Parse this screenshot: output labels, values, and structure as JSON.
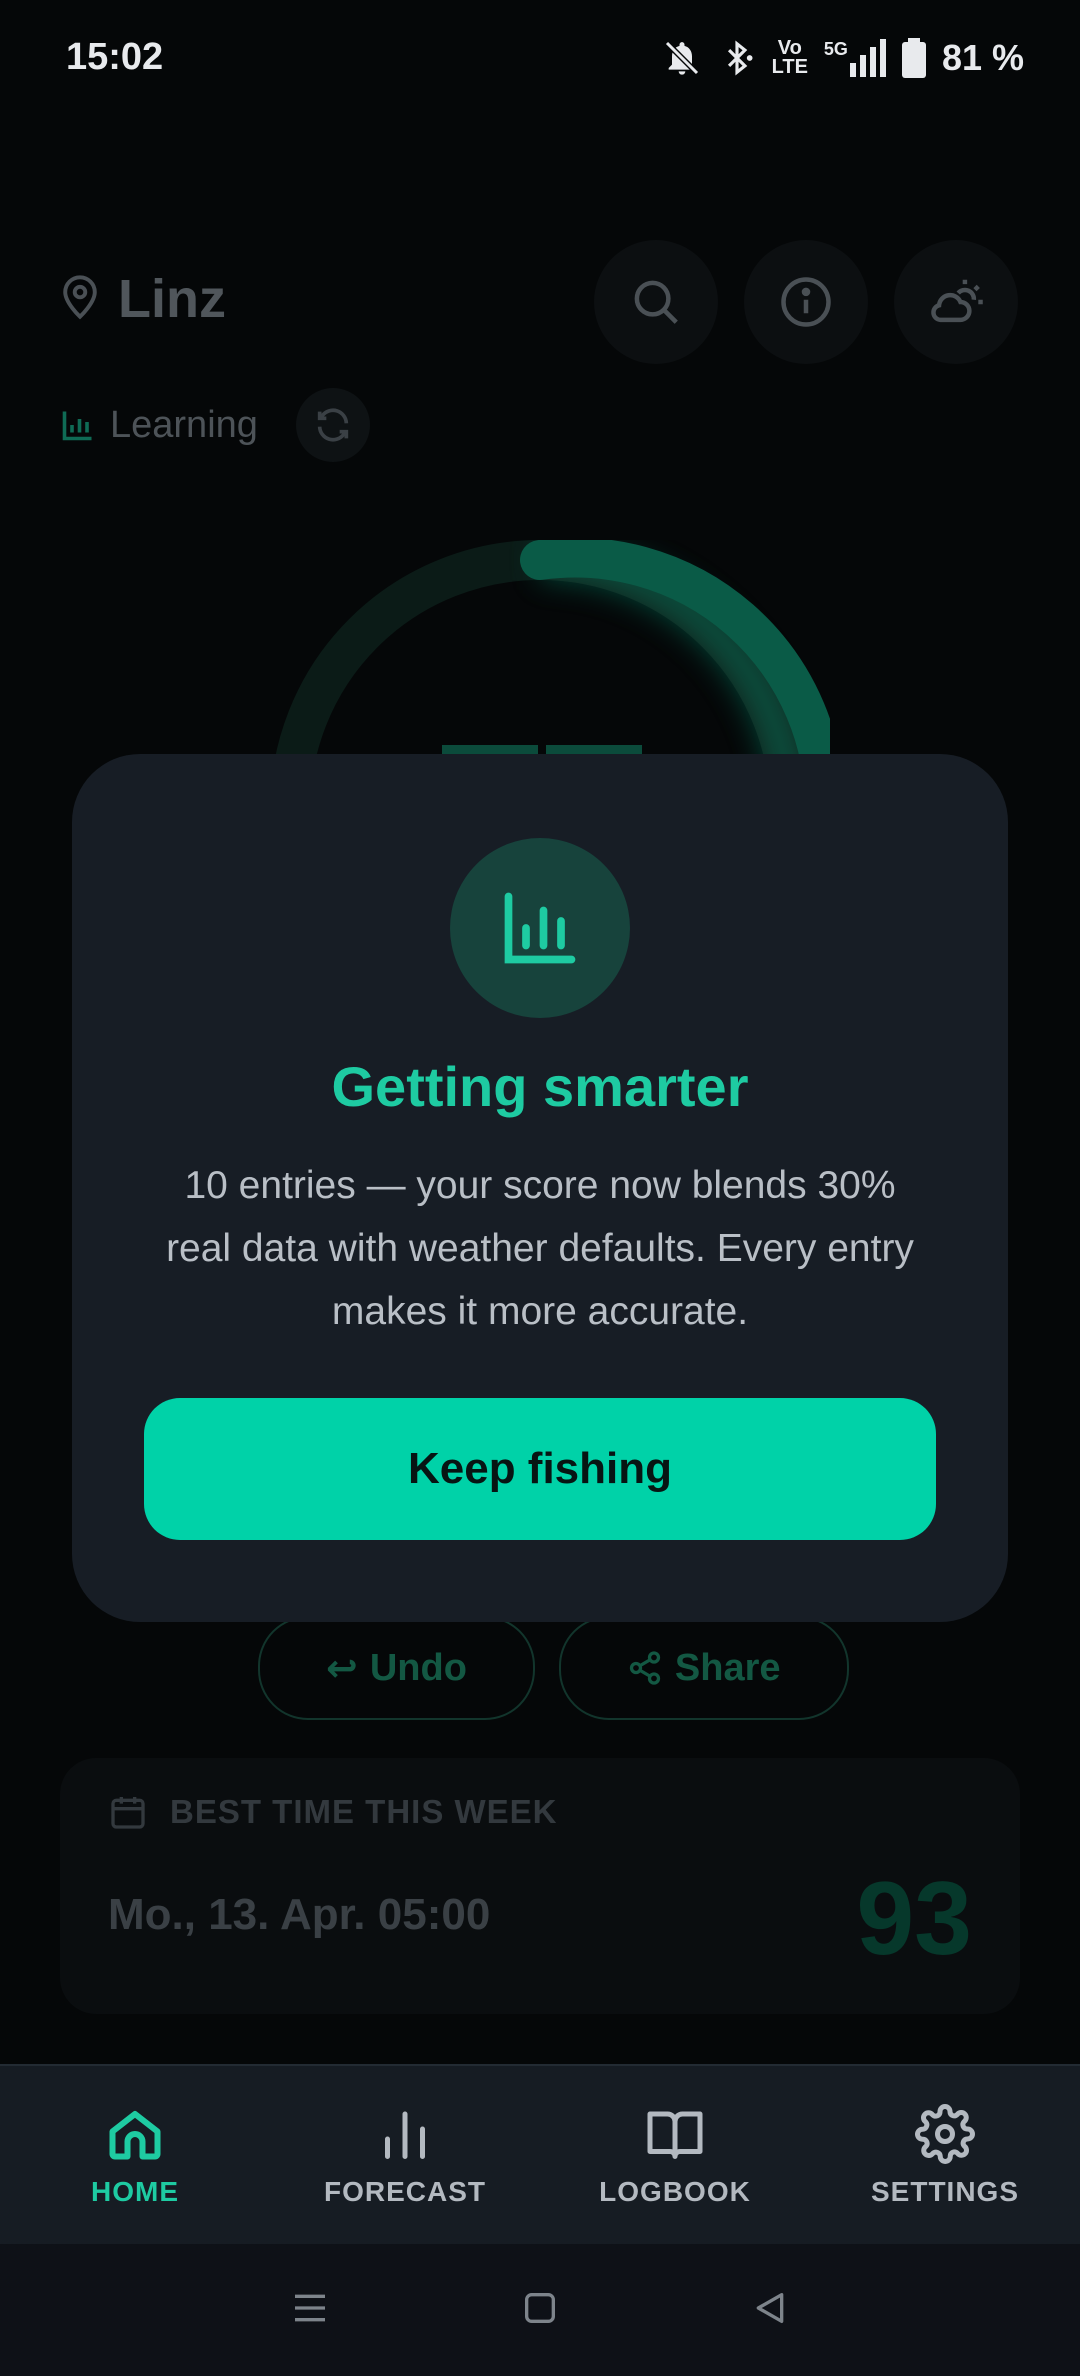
{
  "status_bar": {
    "time": "15:02",
    "network": [
      "Vo",
      "LTE"
    ],
    "signal": "5G",
    "battery": "81 %"
  },
  "header": {
    "location": "Linz",
    "learning_label": "Learning"
  },
  "actions": {
    "undo_label": "Undo",
    "share_label": "Share"
  },
  "best_time": {
    "title": "BEST TIME THIS WEEK",
    "date": "Mo., 13. Apr. 05:00",
    "score": "93"
  },
  "dialog": {
    "title": "Getting smarter",
    "body": "10 entries — your score now blends 30% real data with weather defaults. Every entry makes it more accurate.",
    "button": "Keep fishing"
  },
  "nav": {
    "items": [
      {
        "label": "HOME",
        "icon": "home-icon",
        "active": true
      },
      {
        "label": "FORECAST",
        "icon": "bar-chart-icon",
        "active": false
      },
      {
        "label": "LOGBOOK",
        "icon": "book-icon",
        "active": false
      },
      {
        "label": "SETTINGS",
        "icon": "gear-icon",
        "active": false
      }
    ]
  },
  "colors": {
    "accent": "#00d2a8",
    "dialog_bg": "#171d25",
    "nav_bg": "#161c23"
  }
}
